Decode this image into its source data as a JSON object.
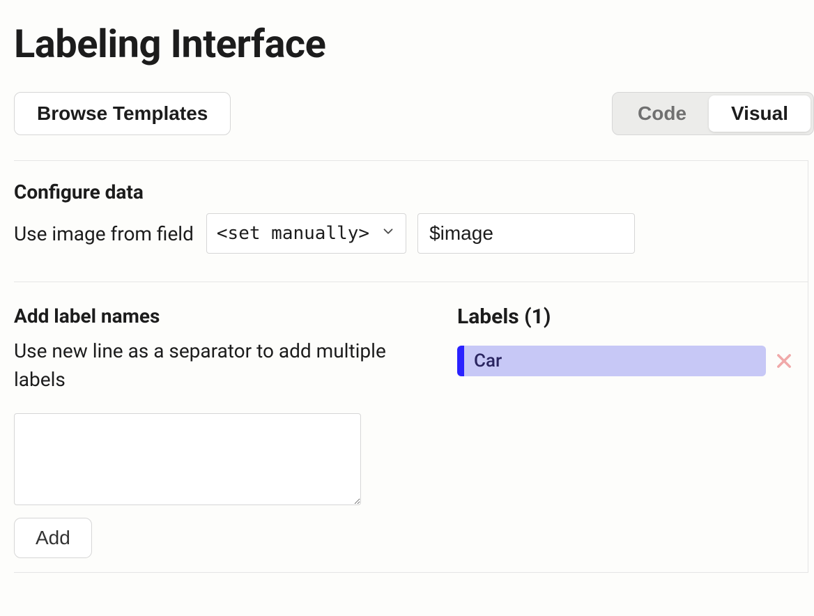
{
  "header": {
    "title": "Labeling Interface"
  },
  "toolbar": {
    "browse_templates": "Browse Templates",
    "tabs": {
      "code": "Code",
      "visual": "Visual"
    }
  },
  "configure_data": {
    "heading": "Configure data",
    "use_image_label": "Use image from field",
    "select_value": "<set manually>",
    "input_value": "$image"
  },
  "labels_left": {
    "heading": "Add label names",
    "description": "Use new line as a separator to add multiple labels",
    "textarea_value": "",
    "add_button": "Add"
  },
  "labels_right": {
    "heading": "Labels (1)",
    "items": [
      {
        "name": "Car"
      }
    ]
  }
}
